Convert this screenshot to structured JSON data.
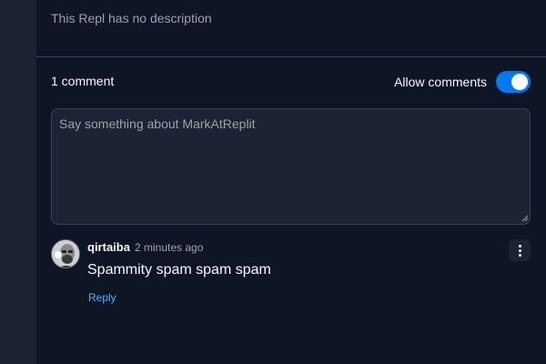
{
  "repl": {
    "description": "This Repl has no description"
  },
  "comments_section": {
    "count_label": "1 comment",
    "allow_comments_label": "Allow comments",
    "allow_comments_enabled": true,
    "input_placeholder": "Say something about MarkAtReplit"
  },
  "comments": [
    {
      "username": "qirtaiba",
      "timestamp": "2 minutes ago",
      "text": "Spammity spam spam spam",
      "reply_label": "Reply"
    }
  ],
  "colors": {
    "background": "#0e1525",
    "surface": "#1c2333",
    "accent": "#0079f2",
    "link": "#57abff"
  }
}
